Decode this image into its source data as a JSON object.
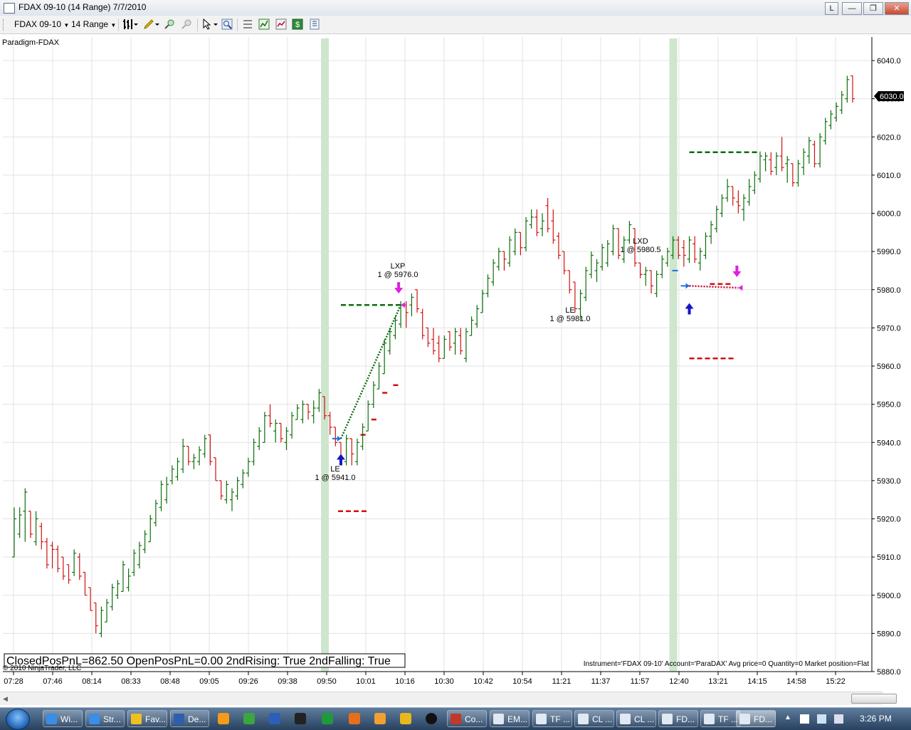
{
  "window": {
    "title": "FDAX 09-10 (14 Range)  7/7/2010"
  },
  "window_buttons": {
    "l": "L",
    "min": "—",
    "max": "❐",
    "close": "✕"
  },
  "toolbar": {
    "instrument": "FDAX 09-10",
    "period": "14 Range"
  },
  "chart": {
    "label": "Paradigm-FDAX",
    "last_price": "6030.0",
    "copyright": "© 2010 NinjaTrader, LLC",
    "status_box": "ClosedPosPnL=862.50 OpenPosPnL=0.00 2ndRising: True 2ndFalling: True",
    "position_info": "Instrument='FDAX 09-10' Account='ParaDAX' Avg price=0 Quantity=0 Market position=Flat",
    "annotations": {
      "le1_tag": "LE",
      "le1_fill": "1 @ 5941.0",
      "lxp_tag": "LXP",
      "lxp_fill": "1 @ 5976.0",
      "le2_tag": "LE",
      "le2_fill": "1 @ 5981.0",
      "lxd_tag": "LXD",
      "lxd_fill": "1 @ 5980.5"
    }
  },
  "chart_data": {
    "type": "ohlc",
    "instrument": "FDAX 09-10",
    "bar_period": "14 Range",
    "date": "7/7/2010",
    "ylim": [
      5880,
      6040
    ],
    "y_ticks": [
      "5880.0",
      "5890.0",
      "5900.0",
      "5910.0",
      "5920.0",
      "5930.0",
      "5940.0",
      "5950.0",
      "5960.0",
      "5970.0",
      "5980.0",
      "5990.0",
      "6000.0",
      "6010.0",
      "6020.0",
      "6030.0",
      "6040.0"
    ],
    "x_ticks": [
      "07:28",
      "07:46",
      "08:14",
      "08:33",
      "08:48",
      "09:05",
      "09:26",
      "09:38",
      "09:50",
      "10:01",
      "10:16",
      "10:30",
      "10:42",
      "10:54",
      "11:21",
      "11:37",
      "11:57",
      "12:40",
      "13:21",
      "14:15",
      "14:58",
      "15:22"
    ],
    "trades": [
      {
        "signal": "LE",
        "side": "long entry",
        "qty": 1,
        "price": 5941.0,
        "time": "09:50"
      },
      {
        "signal": "LXP",
        "side": "long exit",
        "qty": 1,
        "price": 5976.0,
        "time": "10:16"
      },
      {
        "signal": "LE",
        "side": "long entry",
        "qty": 1,
        "price": 5981.0,
        "time": "11:21"
      },
      {
        "signal": "LXD",
        "side": "long exit",
        "qty": 1,
        "price": 5980.5,
        "time": "11:57"
      }
    ],
    "levels": {
      "green": [
        5976,
        6016
      ],
      "red": [
        5922,
        5962,
        5981.5
      ]
    },
    "bars": [
      [
        5910,
        5923,
        5910,
        5920
      ],
      [
        5916,
        5923,
        5915,
        5921
      ],
      [
        5922,
        5928,
        5914,
        5927
      ],
      [
        5922,
        5922,
        5915,
        5916
      ],
      [
        5914,
        5922,
        5913,
        5920
      ],
      [
        5918,
        5919,
        5912,
        5914
      ],
      [
        5914,
        5915,
        5907,
        5908
      ],
      [
        5913,
        5914,
        5907,
        5912
      ],
      [
        5912,
        5913,
        5906,
        5907
      ],
      [
        5910,
        5910,
        5904,
        5905
      ],
      [
        5908,
        5908,
        5903,
        5904
      ],
      [
        5906,
        5912,
        5905,
        5911
      ],
      [
        5910,
        5911,
        5904,
        5905
      ],
      [
        5906,
        5906,
        5900,
        5900
      ],
      [
        5902,
        5902,
        5896,
        5896
      ],
      [
        5898,
        5898,
        5890,
        5892
      ],
      [
        5890,
        5897,
        5889,
        5896
      ],
      [
        5893,
        5899,
        5893,
        5898
      ],
      [
        5897,
        5903,
        5896,
        5902
      ],
      [
        5900,
        5904,
        5899,
        5903
      ],
      [
        5901,
        5909,
        5901,
        5908
      ],
      [
        5902,
        5907,
        5901,
        5905
      ],
      [
        5906,
        5912,
        5905,
        5911
      ],
      [
        5908,
        5914,
        5907,
        5913
      ],
      [
        5912,
        5917,
        5911,
        5916
      ],
      [
        5914,
        5921,
        5914,
        5920
      ],
      [
        5919,
        5925,
        5918,
        5924
      ],
      [
        5923,
        5930,
        5922,
        5929
      ],
      [
        5925,
        5931,
        5924,
        5929
      ],
      [
        5930,
        5934,
        5929,
        5933
      ],
      [
        5931,
        5936,
        5930,
        5935
      ],
      [
        5933,
        5941,
        5932,
        5939
      ],
      [
        5939,
        5939,
        5934,
        5935
      ],
      [
        5935,
        5937,
        5933,
        5936
      ],
      [
        5935,
        5939,
        5934,
        5938
      ],
      [
        5937,
        5942,
        5936,
        5941
      ],
      [
        5942,
        5942,
        5934,
        5935
      ],
      [
        5936,
        5936,
        5930,
        5930
      ],
      [
        5930,
        5930,
        5925,
        5926
      ],
      [
        5925,
        5930,
        5924,
        5929
      ],
      [
        5925,
        5928,
        5922,
        5927
      ],
      [
        5926,
        5931,
        5925,
        5930
      ],
      [
        5929,
        5933,
        5928,
        5932
      ],
      [
        5932,
        5936,
        5931,
        5935
      ],
      [
        5935,
        5941,
        5934,
        5940
      ],
      [
        5939,
        5944,
        5938,
        5943
      ],
      [
        5940,
        5948,
        5940,
        5947
      ],
      [
        5947,
        5950,
        5944,
        5945
      ],
      [
        5943,
        5946,
        5940,
        5945
      ],
      [
        5945,
        5945,
        5940,
        5941
      ],
      [
        5940,
        5944,
        5938,
        5943
      ],
      [
        5942,
        5948,
        5941,
        5947
      ],
      [
        5946,
        5950,
        5946,
        5949
      ],
      [
        5946,
        5951,
        5945,
        5950
      ],
      [
        5950,
        5950,
        5946,
        5948
      ],
      [
        5947,
        5951,
        5945,
        5949
      ],
      [
        5949,
        5954,
        5948,
        5953
      ],
      [
        5952,
        5952,
        5946,
        5947
      ],
      [
        5947,
        5948,
        5942,
        5944
      ],
      [
        5944,
        5944,
        5939,
        5940
      ],
      [
        5940,
        5940,
        5935,
        5936
      ],
      [
        5935,
        5942,
        5934,
        5941
      ],
      [
        5941,
        5941,
        5934,
        5937
      ],
      [
        5935,
        5941,
        5934,
        5940
      ],
      [
        5939,
        5945,
        5938,
        5944
      ],
      [
        5943,
        5951,
        5943,
        5950
      ],
      [
        5950,
        5956,
        5949,
        5955
      ],
      [
        5954,
        5961,
        5954,
        5960
      ],
      [
        5958,
        5967,
        5958,
        5966
      ],
      [
        5964,
        5970,
        5963,
        5969
      ],
      [
        5968,
        5973,
        5967,
        5972
      ],
      [
        5971,
        5977,
        5970,
        5976
      ],
      [
        5976,
        5977,
        5970,
        5974
      ],
      [
        5976,
        5979,
        5973,
        5978
      ],
      [
        5980,
        5980,
        5974,
        5975
      ],
      [
        5974,
        5975,
        5967,
        5968
      ],
      [
        5970,
        5970,
        5965,
        5966
      ],
      [
        5967,
        5970,
        5963,
        5964
      ],
      [
        5966,
        5968,
        5961,
        5962
      ],
      [
        5962,
        5968,
        5962,
        5967
      ],
      [
        5969,
        5969,
        5964,
        5965
      ],
      [
        5966,
        5970,
        5963,
        5969
      ],
      [
        5968,
        5970,
        5963,
        5964
      ],
      [
        5962,
        5970,
        5961,
        5969
      ],
      [
        5968,
        5973,
        5968,
        5972
      ],
      [
        5971,
        5976,
        5970,
        5975
      ],
      [
        5974,
        5980,
        5974,
        5979
      ],
      [
        5979,
        5984,
        5978,
        5983
      ],
      [
        5982,
        5988,
        5981,
        5987
      ],
      [
        5986,
        5991,
        5985,
        5990
      ],
      [
        5990,
        5990,
        5985,
        5988
      ],
      [
        5987,
        5994,
        5986,
        5993
      ],
      [
        5990,
        5996,
        5989,
        5995
      ],
      [
        5995,
        5995,
        5989,
        5991
      ],
      [
        5991,
        5999,
        5990,
        5998
      ],
      [
        5997,
        6001,
        5996,
        5999
      ],
      [
        5999,
        6001,
        5994,
        5995
      ],
      [
        5996,
        6000,
        5994,
        5998
      ],
      [
        6002,
        6004,
        5995,
        5996
      ],
      [
        5998,
        6001,
        5992,
        5993
      ],
      [
        5994,
        5995,
        5988,
        5989
      ],
      [
        5990,
        5990,
        5984,
        5985
      ],
      [
        5985,
        5985,
        5979,
        5980
      ],
      [
        5982,
        5982,
        5974,
        5975
      ],
      [
        5975,
        5980,
        5972,
        5979
      ],
      [
        5978,
        5986,
        5977,
        5985
      ],
      [
        5984,
        5990,
        5983,
        5989
      ],
      [
        5985,
        5988,
        5982,
        5987
      ],
      [
        5986,
        5992,
        5985,
        5991
      ],
      [
        5987,
        5993,
        5986,
        5992
      ],
      [
        5990,
        5997,
        5989,
        5996
      ],
      [
        5996,
        5996,
        5988,
        5989
      ],
      [
        5988,
        5994,
        5987,
        5993
      ],
      [
        5993,
        5998,
        5992,
        5997
      ],
      [
        5996,
        5996,
        5986,
        5987
      ],
      [
        5987,
        5987,
        5983,
        5984
      ],
      [
        5984,
        5986,
        5981,
        5985
      ],
      [
        5985,
        5985,
        5979,
        5981
      ],
      [
        5979,
        5985,
        5978,
        5984
      ],
      [
        5984,
        5989,
        5983,
        5988
      ],
      [
        5987,
        5991,
        5986,
        5990
      ],
      [
        5989,
        5994,
        5988,
        5993
      ],
      [
        5993,
        5994,
        5988,
        5989
      ],
      [
        5991,
        5993,
        5986,
        5989
      ],
      [
        5988,
        5994,
        5987,
        5993
      ],
      [
        5992,
        5994,
        5987,
        5988
      ],
      [
        5987,
        5991,
        5985,
        5990
      ],
      [
        5989,
        5995,
        5988,
        5994
      ],
      [
        5994,
        5998,
        5992,
        5997
      ],
      [
        5996,
        6002,
        5995,
        6001
      ],
      [
        6000,
        6005,
        5999,
        6004
      ],
      [
        6004,
        6009,
        6003,
        6007
      ],
      [
        6007,
        6007,
        6002,
        6004
      ],
      [
        6003,
        6006,
        6000,
        6002
      ],
      [
        6001,
        6005,
        5998,
        6004
      ],
      [
        6003,
        6009,
        6002,
        6007
      ],
      [
        6006,
        6011,
        6005,
        6010
      ],
      [
        6009,
        6016,
        6008,
        6015
      ],
      [
        6014,
        6016,
        6011,
        6015
      ],
      [
        6014,
        6016,
        6010,
        6011
      ],
      [
        6012,
        6016,
        6010,
        6015
      ],
      [
        6015,
        6020,
        6011,
        6012
      ],
      [
        6013,
        6015,
        6008,
        6014
      ],
      [
        6013,
        6013,
        6007,
        6008
      ],
      [
        6008,
        6014,
        6007,
        6013
      ],
      [
        6012,
        6017,
        6010,
        6016
      ],
      [
        6015,
        6020,
        6013,
        6019
      ],
      [
        6018,
        6019,
        6012,
        6013
      ],
      [
        6013,
        6021,
        6012,
        6020
      ],
      [
        6019,
        6025,
        6018,
        6024
      ],
      [
        6023,
        6027,
        6022,
        6026
      ],
      [
        6025,
        6029,
        6024,
        6028
      ],
      [
        6027,
        6032,
        6026,
        6031
      ],
      [
        6030,
        6036,
        6029,
        6035
      ],
      [
        6036,
        6036,
        6029,
        6030
      ]
    ]
  },
  "taskbar": {
    "buttons": [
      "Wi...",
      "Str...",
      "Fav...",
      "De...",
      "Co...",
      "EM...",
      "TF ...",
      "CL ...",
      "CL ...",
      "FD...",
      "TF ...",
      "FD..."
    ],
    "clock": "3:26 PM"
  }
}
